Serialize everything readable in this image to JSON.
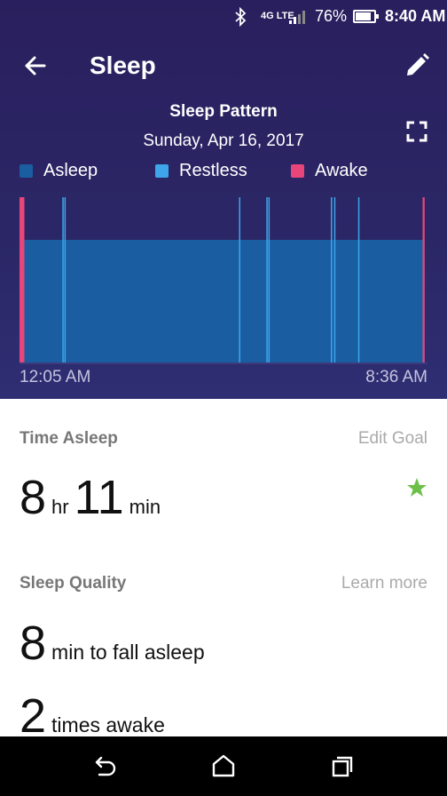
{
  "status_bar": {
    "network": "4G LTE",
    "battery": "76%",
    "time": "8:40 AM"
  },
  "app_bar": {
    "title": "Sleep",
    "back_icon": "arrow-back-icon",
    "edit_icon": "pencil-icon"
  },
  "chart": {
    "title": "Sleep Pattern",
    "date": "Sunday, Apr 16, 2017",
    "fullscreen_icon": "fullscreen-icon",
    "legend": [
      {
        "label": "Asleep",
        "color": "#1a5da1"
      },
      {
        "label": "Restless",
        "color": "#3ea5ea"
      },
      {
        "label": "Awake",
        "color": "#e8467a"
      }
    ],
    "start_label": "12:05 AM",
    "end_label": "8:36 AM"
  },
  "chart_data": {
    "type": "timeline",
    "start": "12:05 AM",
    "end": "8:36 AM",
    "stages": [
      "Asleep",
      "Restless",
      "Awake"
    ],
    "segments": [
      {
        "stage": "Awake",
        "from": 0.0,
        "to": 0.012
      },
      {
        "stage": "Asleep",
        "from": 0.012,
        "to": 0.993
      },
      {
        "stage": "Restless",
        "from": 0.105,
        "to": 0.108
      },
      {
        "stage": "Restless",
        "from": 0.11,
        "to": 0.113
      },
      {
        "stage": "Restless",
        "from": 0.538,
        "to": 0.541
      },
      {
        "stage": "Restless",
        "from": 0.605,
        "to": 0.608
      },
      {
        "stage": "Restless",
        "from": 0.61,
        "to": 0.613
      },
      {
        "stage": "Restless",
        "from": 0.763,
        "to": 0.766
      },
      {
        "stage": "Restless",
        "from": 0.771,
        "to": 0.774
      },
      {
        "stage": "Restless",
        "from": 0.83,
        "to": 0.833
      },
      {
        "stage": "Awake",
        "from": 0.988,
        "to": 0.993
      }
    ],
    "colors": {
      "Asleep": "#1a5da1",
      "Restless": "#3ea5ea",
      "Awake": "#e8467a"
    }
  },
  "time_asleep": {
    "label": "Time Asleep",
    "link": "Edit Goal",
    "hours": "8",
    "hours_unit": "hr",
    "minutes": "11",
    "minutes_unit": "min",
    "star_color": "#6cc04a"
  },
  "sleep_quality": {
    "label": "Sleep Quality",
    "link": "Learn more",
    "fall_asleep_value": "8",
    "fall_asleep_text": "min to fall asleep",
    "awake_value": "2",
    "awake_text": "times awake"
  },
  "nav": {
    "back_icon": "nav-back-icon",
    "home_icon": "nav-home-icon",
    "recents_icon": "nav-recents-icon"
  }
}
